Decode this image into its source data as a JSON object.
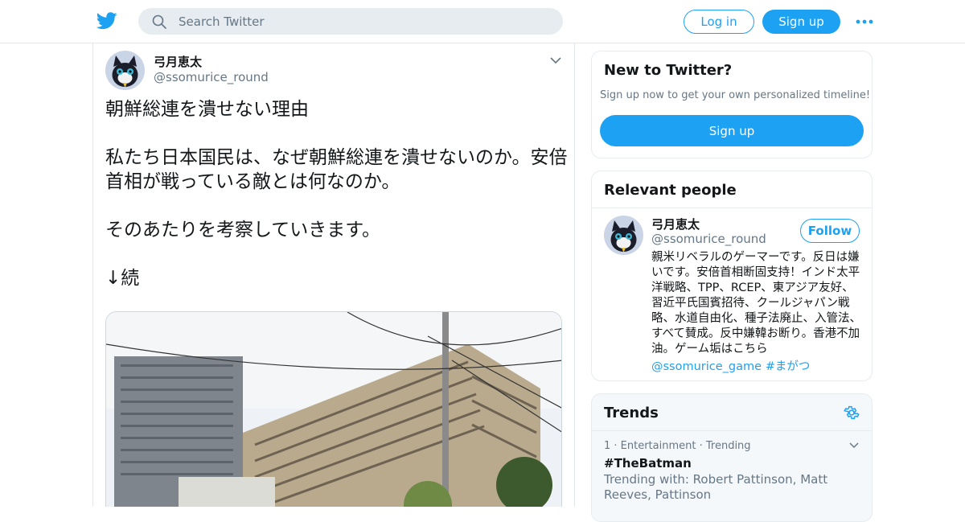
{
  "header": {
    "search_placeholder": "Search Twitter",
    "login_label": "Log in",
    "signup_label": "Sign up",
    "logo_icon": "twitter-bird-icon",
    "more_icon": "more-dots-icon",
    "accent_color": "#1da1f2"
  },
  "tweet": {
    "author_name": "弓月恵太",
    "author_handle": "@ssomurice_round",
    "text": "朝鮮総連を潰せない理由\n\n私たち日本国民は、なぜ朝鮮総連を潰せないのか。安倍首相が戦っている敵とは何なのか。\n\nそのあたりを考察していきます。\n\n↓続"
  },
  "new_to_twitter": {
    "title": "New to Twitter?",
    "subtitle": "Sign up now to get your own personalized timeline!",
    "button_label": "Sign up"
  },
  "relevant_people": {
    "title": "Relevant people",
    "name": "弓月恵太",
    "handle": "@ssomurice_round",
    "follow_label": "Follow",
    "bio": "親米リベラルのゲーマーです。反日は嫌いです。安倍首相断固支持！インド太平洋戦略、TPP、RCEP、東アジア友好、習近平氏国賓招待、クールジャパン戦略、水道自由化、種子法廃止、入管法、すべて賛成。反中嫌韓お断り。香港不加油。ゲーム垢はこちら",
    "link_handle": "@ssomurice_game",
    "link_hashtag": "#まがつ"
  },
  "trends": {
    "title": "Trends",
    "items": [
      {
        "meta": "1 · Entertainment · Trending",
        "name": "#TheBatman",
        "with": "Trending with: Robert Pattinson, Matt Reeves, Pattinson"
      }
    ]
  }
}
